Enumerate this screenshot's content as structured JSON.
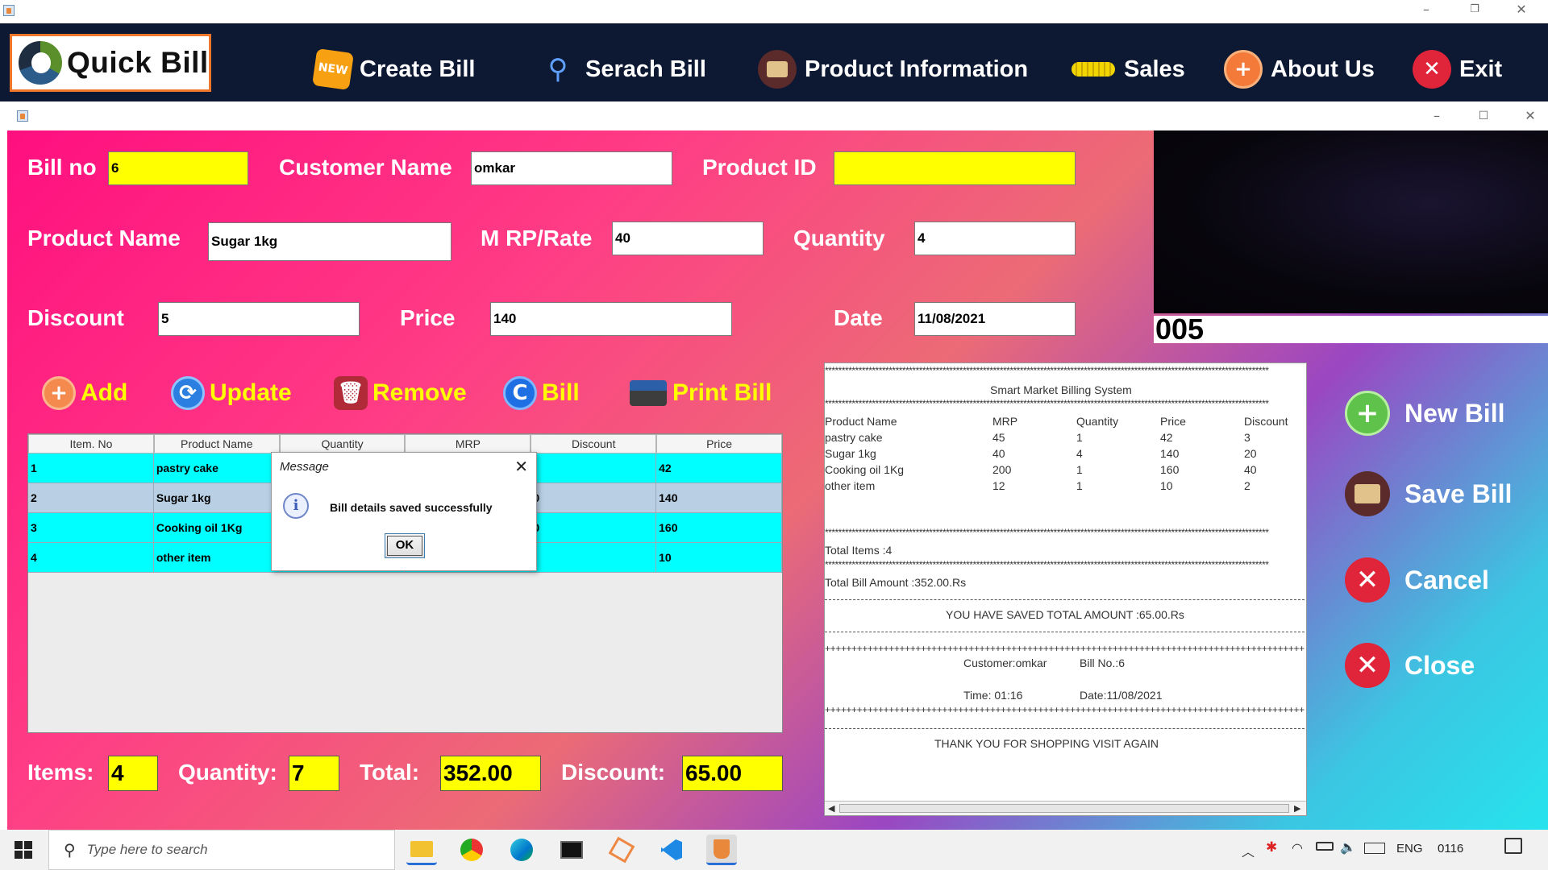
{
  "menu": {
    "brand": "Quick Bill",
    "items": [
      {
        "label": "Create Bill",
        "icon": "new-badge-icon"
      },
      {
        "label": "Serach Bill",
        "icon": "magnifier-icon"
      },
      {
        "label": "Product Information",
        "icon": "product-box-icon"
      },
      {
        "label": "Sales",
        "icon": "coins-icon"
      },
      {
        "label": "About Us",
        "icon": "plus-circle-icon"
      },
      {
        "label": "Exit",
        "icon": "close-circle-icon"
      }
    ]
  },
  "form": {
    "bill_no": {
      "label": "Bill no",
      "value": "6"
    },
    "customer_name": {
      "label": "Customer Name",
      "value": "omkar"
    },
    "product_id": {
      "label": "Product ID",
      "value": ""
    },
    "product_name": {
      "label": "Product Name",
      "value": "Sugar 1kg"
    },
    "mrp": {
      "label": "M RP/Rate",
      "value": "40"
    },
    "quantity": {
      "label": "Quantity",
      "value": "4"
    },
    "discount": {
      "label": "Discount",
      "value": "5"
    },
    "price": {
      "label": "Price",
      "value": "140"
    },
    "date": {
      "label": "Date",
      "value": "11/08/2021"
    }
  },
  "actions": {
    "add": "Add",
    "update": "Update",
    "remove": "Remove",
    "bill": "Bill",
    "print": "Print Bill"
  },
  "table": {
    "columns": [
      "Item. No",
      "Product Name",
      "Quantity",
      "MRP",
      "Discount",
      "Price"
    ],
    "rows": [
      {
        "no": "1",
        "name": "pastry cake",
        "price": "42"
      },
      {
        "no": "2",
        "name": "Sugar 1kg",
        "discount_fragment": "0",
        "price": "140"
      },
      {
        "no": "3",
        "name": "Cooking oil 1Kg",
        "discount_fragment": "0",
        "price": "160"
      },
      {
        "no": "4",
        "name": "other item",
        "price": "10"
      }
    ]
  },
  "dialog": {
    "title": "Message",
    "message": "Bill details saved successfully",
    "ok": "OK"
  },
  "totals": {
    "items_label": "Items:",
    "items": "4",
    "quantity_label": "Quantity:",
    "quantity": "7",
    "total_label": "Total:",
    "total": "352.00",
    "discount_label": "Discount:",
    "discount": "65.00"
  },
  "counter": "005",
  "receipt": {
    "title": "Smart Market Billing System",
    "columns": [
      "Product Name",
      "MRP",
      "Quantity",
      "Price",
      "Discount"
    ],
    "rows": [
      [
        "pastry cake",
        "45",
        "1",
        "42",
        "3"
      ],
      [
        "Sugar 1kg",
        "40",
        "4",
        "140",
        "20"
      ],
      [
        "Cooking oil 1Kg",
        "200",
        "1",
        "160",
        "40"
      ],
      [
        "other item",
        "12",
        "1",
        "10",
        "2"
      ]
    ],
    "total_items": "Total Items :4",
    "total_amount": "Total Bill Amount :352.00.Rs",
    "saved": "YOU HAVE SAVED TOTAL AMOUNT :65.00.Rs",
    "customer": "Customer:omkar",
    "bill_no": "Bill No.:6",
    "time": "Time: 01:16",
    "date": "Date:11/08/2021",
    "thanks": "THANK YOU FOR SHOPPING VISIT AGAIN"
  },
  "side_buttons": {
    "new_bill": "New Bill",
    "save_bill": "Save Bill",
    "cancel": "Cancel",
    "close": "Close"
  },
  "taskbar": {
    "search_placeholder": "Type here to search",
    "language": "ENG",
    "clock": "01‎16"
  },
  "colors": {
    "field_highlight": "#ffff00",
    "table_row": "#00ffff",
    "menubar": "#0d1832"
  }
}
